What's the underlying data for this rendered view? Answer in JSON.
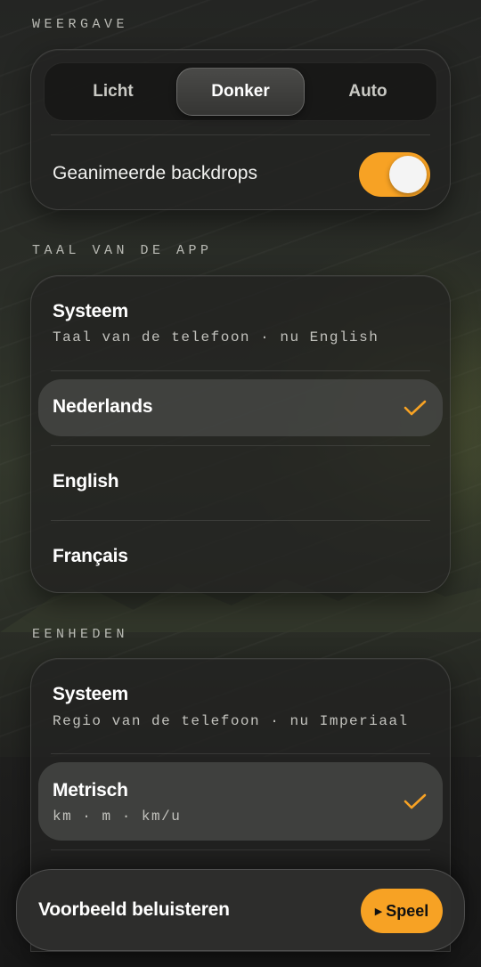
{
  "sections": {
    "appearance_label": "WEERGAVE",
    "language_label": "TAAL VAN DE APP",
    "units_label": "EENHEDEN"
  },
  "appearance": {
    "segments": [
      "Licht",
      "Donker",
      "Auto"
    ],
    "selected": "Donker",
    "animated_backdrops_label": "Geanimeerde backdrops",
    "animated_backdrops_on": true
  },
  "language": {
    "options": [
      {
        "title": "Systeem",
        "subtitle": "Taal van de telefoon · nu English"
      },
      {
        "title": "Nederlands",
        "selected": true
      },
      {
        "title": "English"
      },
      {
        "title": "Français"
      }
    ]
  },
  "units": {
    "options": [
      {
        "title": "Systeem",
        "subtitle": "Regio van de telefoon · nu Imperiaal"
      },
      {
        "title": "Metrisch",
        "subtitle": "km · m · km/u",
        "selected": true
      }
    ]
  },
  "bottom_bar": {
    "label": "Voorbeeld beluisteren",
    "play_label": "Speel",
    "play_icon": "play-icon"
  },
  "colors": {
    "accent": "#f7a224",
    "card_bg": "#232321",
    "text_primary": "#ffffff",
    "text_muted": "#c2c2bd"
  }
}
